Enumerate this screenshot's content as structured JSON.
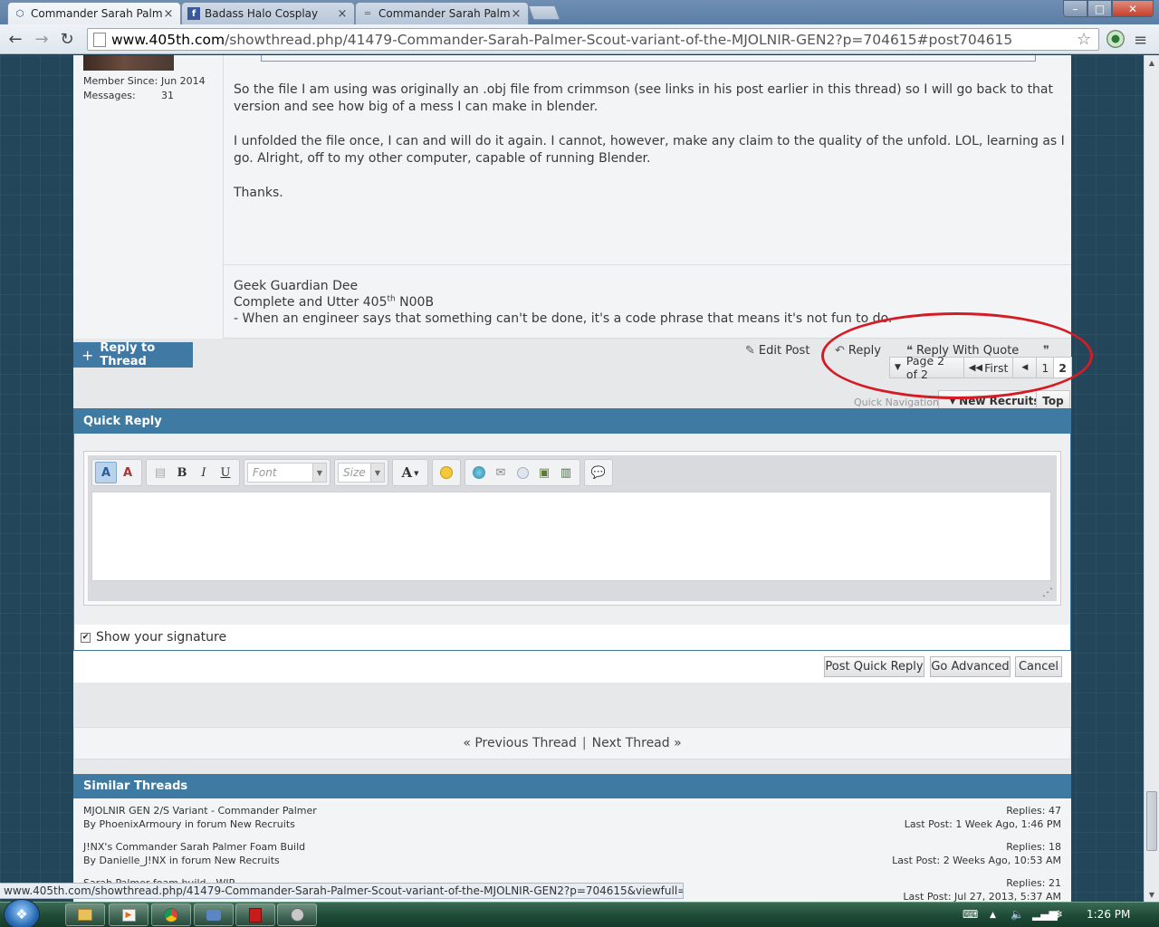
{
  "browser": {
    "tabs": [
      {
        "title": "Commander Sarah Palmer",
        "close": "×",
        "active": true
      },
      {
        "title": "Badass Halo Cosplay",
        "close": "×",
        "active": false
      },
      {
        "title": "Commander Sarah Palmer",
        "close": "×",
        "active": false
      }
    ],
    "window_controls": {
      "minimize": "–",
      "maximize": "□",
      "close": "✕"
    },
    "nav": {
      "back": "←",
      "forward": "→",
      "reload": "↻"
    },
    "url_domain": "www.405th.com",
    "url_path": "/showthread.php/41479-Commander-Sarah-Palmer-Scout-variant-of-the-MJOLNIR-GEN2?p=704615#post704615",
    "star": "☆",
    "menu": "≡",
    "status_url": "www.405th.com/showthread.php/41479-Commander-Sarah-Palmer-Scout-variant-of-the-MJOLNIR-GEN2?p=704615&viewfull=1#post704615"
  },
  "post": {
    "member_since_label": "Member Since:",
    "member_since_value": "Jun 2014",
    "messages_label": "Messages:",
    "messages_value": "31",
    "paragraphs": [
      "So the file I am using was originally an .obj file from crimmson (see links in his post earlier in this thread) so I will go back to that version and see how big of a mess I can make in blender.",
      "I unfolded the file once, I can and will do it again. I cannot, however, make any claim to the quality of the unfold. LOL, learning as I go. Alright, off to my other computer, capable of running Blender.",
      "Thanks."
    ],
    "signature": {
      "line1": "Geek Guardian Dee",
      "line2_pre": "Complete and Utter 405",
      "line2_sup": "th",
      "line2_post": " N00B",
      "line3": "- When an engineer says that something can't be done, it's a code phrase that means it's not fun to do."
    }
  },
  "actions": {
    "reply_to_thread": "Reply to Thread",
    "reply_to_thread_icon": "+",
    "edit_post": "Edit Post",
    "reply": "Reply",
    "reply_with_quote": "Reply With Quote"
  },
  "pagination": {
    "page_label": "Page 2 of 2",
    "first": "First",
    "pages": [
      "1",
      "2"
    ],
    "current": "2"
  },
  "quick_nav": {
    "label": "Quick Navigation",
    "forum": "New Recruits",
    "top": "Top"
  },
  "quick_reply": {
    "title": "Quick Reply",
    "toolbar": {
      "font_placeholder": "Font",
      "size_placeholder": "Size",
      "bold": "B",
      "italic": "I",
      "underline": "U",
      "text_color": "A"
    },
    "show_signature": "Show your signature",
    "signature_checked": true,
    "buttons": {
      "post": "Post Quick Reply",
      "advanced": "Go Advanced",
      "cancel": "Cancel"
    }
  },
  "thread_nav": {
    "previous": "« Previous Thread",
    "separator": "|",
    "next": "Next Thread »"
  },
  "similar_threads": {
    "title": "Similar Threads",
    "items": [
      {
        "title": "MJOLNIR GEN 2/S Variant - Commander Palmer",
        "by": "By PhoenixArmoury in forum New Recruits",
        "replies": "Replies: 47",
        "last_post": "Last Post: 1 Week Ago, 1:46 PM"
      },
      {
        "title": "J!NX's Commander Sarah Palmer Foam Build",
        "by": "By Danielle_J!NX in forum New Recruits",
        "replies": "Replies: 18",
        "last_post": "Last Post: 2 Weeks Ago, 10:53 AM"
      },
      {
        "title": "Sarah Palmer foam build - WIP",
        "by": "",
        "replies": "Replies: 21",
        "last_post": "Last Post: Jul 27, 2013, 5:37 AM"
      }
    ]
  },
  "taskbar": {
    "clock": "1:26 PM"
  },
  "colors": {
    "header_blue": "#3e7aa1",
    "highlight_red": "#d41c25"
  }
}
